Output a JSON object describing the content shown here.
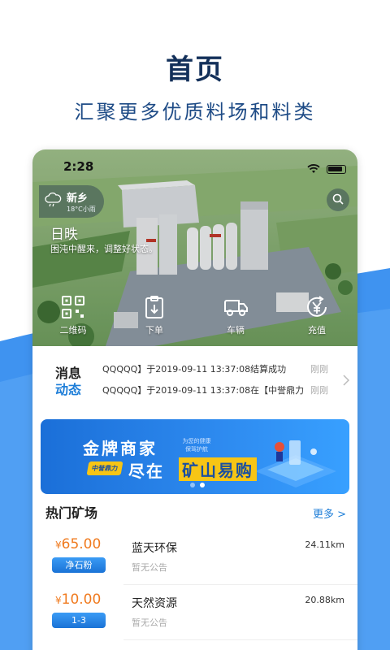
{
  "promo": {
    "title": "首页",
    "subtitle": "汇聚更多优质料场和料类"
  },
  "status_bar": {
    "time": "2:28"
  },
  "weather": {
    "city": "新乡",
    "temp": "18°C小雨",
    "icon": "cloud-rain-icon"
  },
  "hero": {
    "title": "日昳",
    "line": "困沌中醒来，调整好状态。"
  },
  "quick_actions": [
    {
      "label": "二维码",
      "icon": "qrcode-icon"
    },
    {
      "label": "下单",
      "icon": "order-icon"
    },
    {
      "label": "车辆",
      "icon": "truck-icon"
    },
    {
      "label": "充值",
      "icon": "recharge-icon"
    }
  ],
  "news": {
    "label_line1": "消息",
    "label_line2": "动态",
    "items": [
      {
        "text": "QQQQQ】于2019-09-11 13:37:08结算成功",
        "time": "刚刚"
      },
      {
        "text": "QQQQQ】于2019-09-11 13:37:08在【中誉鼎力",
        "time": "刚刚"
      }
    ]
  },
  "banner": {
    "headline": "金牌商家",
    "slogan": "为您的健康\n保驾护航",
    "tag": "中誉鼎力",
    "line_prefix": "尽在",
    "line_highlight": "矿山易购",
    "active_dot": 1
  },
  "hot_mines": {
    "title": "热门矿场",
    "more_label": "更多 >",
    "items": [
      {
        "price": "65.00",
        "currency": "¥",
        "tag": "净石粉",
        "name": "蓝天环保",
        "distance": "24.11km",
        "notice": "暂无公告"
      },
      {
        "price": "10.00",
        "currency": "¥",
        "tag": "1-3",
        "name": "天然资源",
        "distance": "20.88km",
        "notice": "暂无公告"
      }
    ]
  },
  "colors": {
    "accent_blue": "#1e7ed8",
    "price_orange": "#f07a1e",
    "title_navy": "#13305a",
    "highlight_yellow": "#f7c515"
  }
}
